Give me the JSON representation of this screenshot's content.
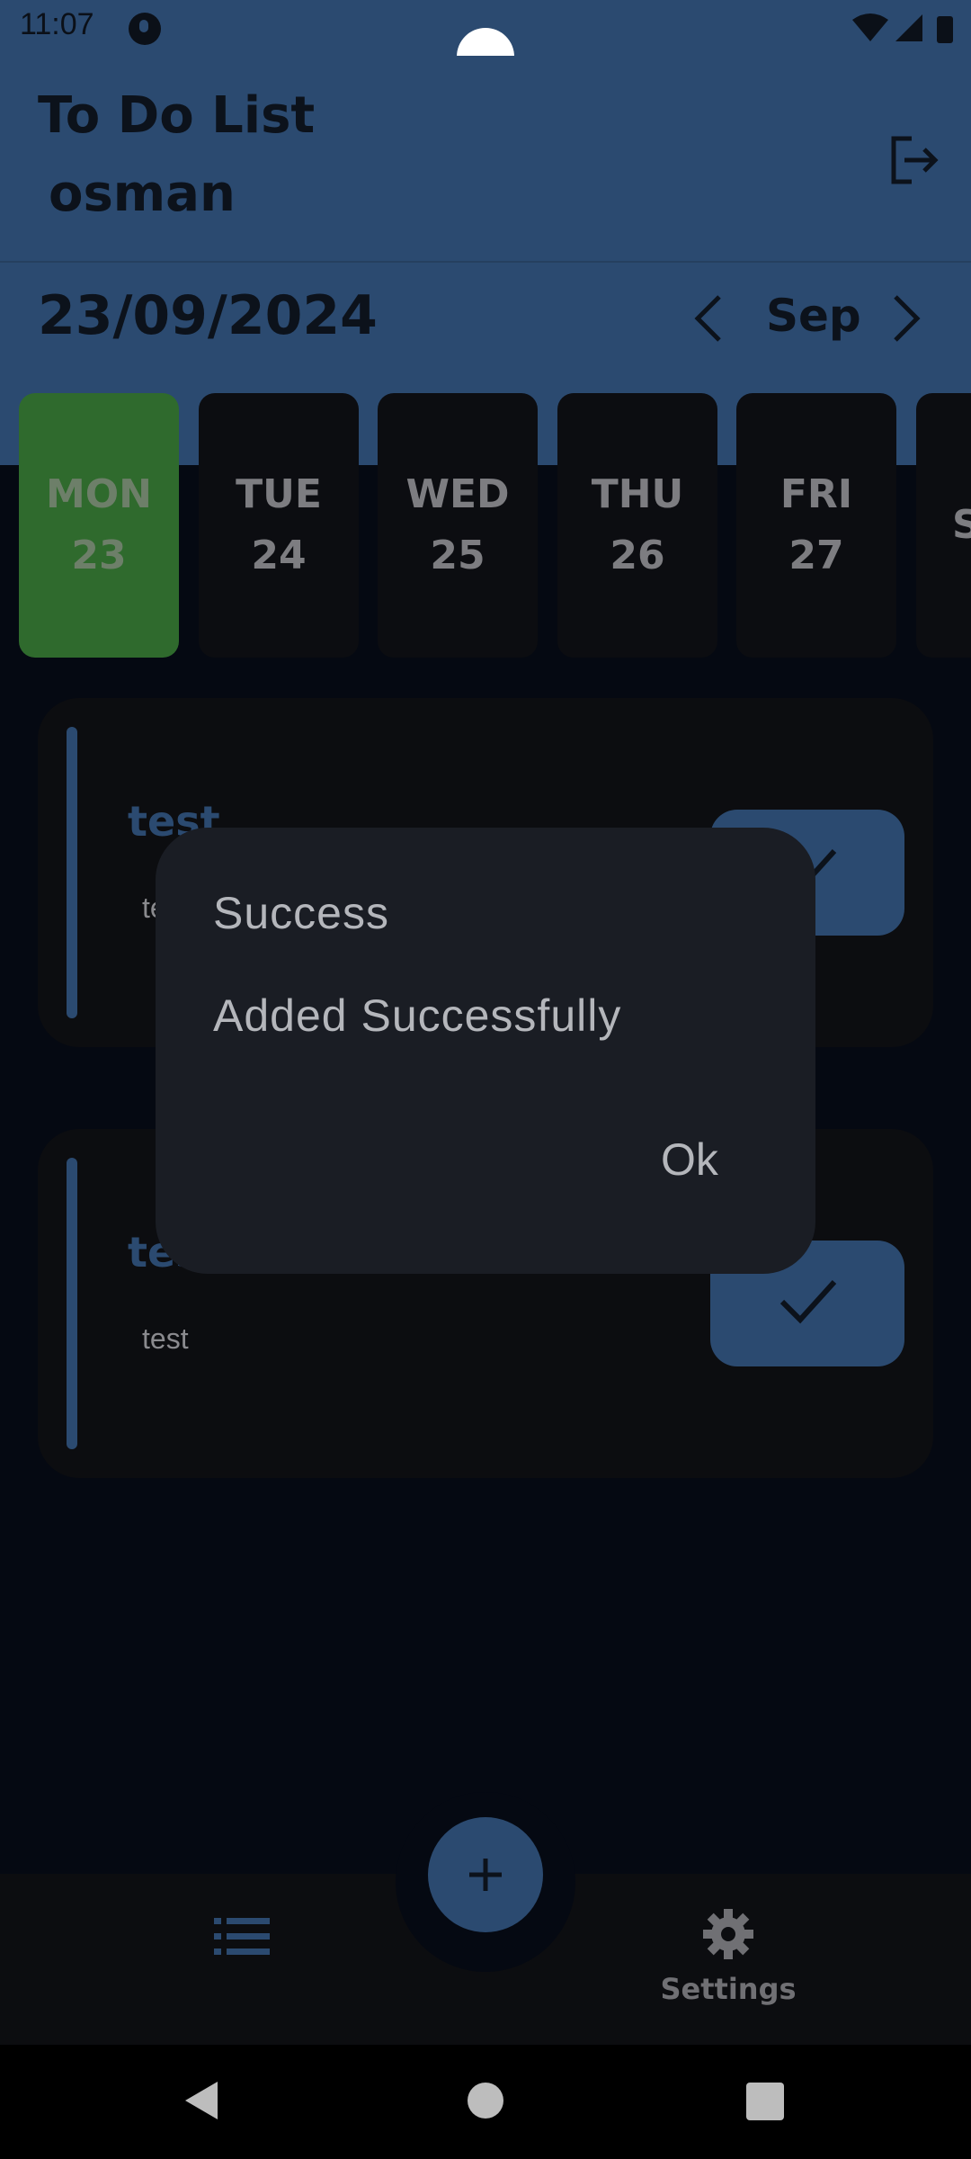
{
  "status_bar": {
    "time": "11:07"
  },
  "header": {
    "title": "To Do List",
    "user": "osman"
  },
  "date_bar": {
    "current_date": "23/09/2024",
    "month": "Sep"
  },
  "days": [
    {
      "name": "MON",
      "num": "23",
      "selected": true
    },
    {
      "name": "TUE",
      "num": "24"
    },
    {
      "name": "WED",
      "num": "25"
    },
    {
      "name": "THU",
      "num": "26"
    },
    {
      "name": "FRI",
      "num": "27"
    },
    {
      "name": "S",
      "num": ""
    }
  ],
  "tasks": [
    {
      "title": "test",
      "desc": "test"
    },
    {
      "title": "test",
      "desc": "test"
    }
  ],
  "dialog": {
    "title": "Success",
    "message": "Added Successfully",
    "ok_label": "Ok"
  },
  "bottom_nav": {
    "settings_label": "Settings"
  },
  "colors": {
    "primary": "#2b4a70",
    "selected_day": "#2f6a2d",
    "dialog_bg": "#1a1d24"
  }
}
